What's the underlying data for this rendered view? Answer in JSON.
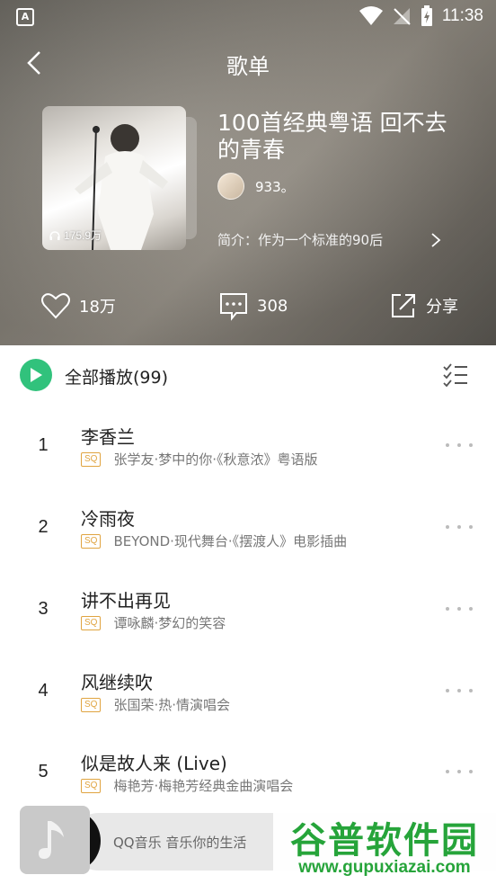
{
  "status_bar": {
    "time": "11:38",
    "app_icon_letter": "A"
  },
  "header": {
    "title": "歌单"
  },
  "playlist": {
    "play_count": "175.9万",
    "title": "100首经典粤语 回不去的青春",
    "creator": "933。",
    "intro": "简介：作为一个标准的90后"
  },
  "actions": {
    "like_count": "18万",
    "comment_count": "308",
    "share_label": "分享"
  },
  "list": {
    "play_all_label": "全部播放(99)",
    "quality_badge": "SQ",
    "songs": [
      {
        "index": "1",
        "title": "李香兰",
        "subtitle": "张学友·梦中的你·《秋意浓》粤语版"
      },
      {
        "index": "2",
        "title": "冷雨夜",
        "subtitle": "BEYOND·现代舞台·《摆渡人》电影插曲"
      },
      {
        "index": "3",
        "title": "讲不出再见",
        "subtitle": "谭咏麟·梦幻的笑容"
      },
      {
        "index": "4",
        "title": "风继续吹",
        "subtitle": "张国荣·热·情演唱会"
      },
      {
        "index": "5",
        "title": "似是故人来 (Live)",
        "subtitle": "梅艳芳·梅艳芳经典金曲演唱会"
      }
    ]
  },
  "mini_player": {
    "text": "QQ音乐 音乐你的生活"
  },
  "watermark": {
    "title": "谷普软件园",
    "url": "www.gupuxiazai.com"
  },
  "colors": {
    "accent": "#31c27c",
    "badge": "#e0a440",
    "watermark": "#26a43a"
  }
}
